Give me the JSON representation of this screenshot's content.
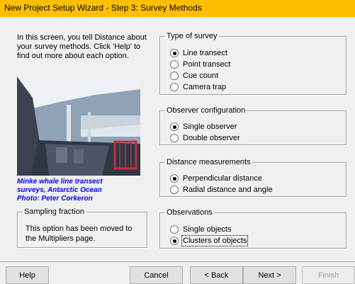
{
  "window": {
    "title": "New Project Setup Wizard - Step 3: Survey Methods"
  },
  "intro": {
    "text": "In this screen, you tell Distance about your survey methods.  Click 'Help' to find out more about each option."
  },
  "photo": {
    "caption_line1": "Minke whale line transect",
    "caption_line2": "surveys, Antarctic Ocean",
    "caption_line3": "Photo: Peter Corkeron"
  },
  "sampling": {
    "legend": "Sampling fraction",
    "text": "This option has been moved to the Multipliers page."
  },
  "type_of_survey": {
    "legend": "Type of survey",
    "options": [
      "Line transect",
      "Point transect",
      "Cue count",
      "Camera trap"
    ],
    "selected": "Line transect"
  },
  "observer_configuration": {
    "legend": "Observer configuration",
    "options": [
      "Single observer",
      "Double observer"
    ],
    "selected": "Single observer"
  },
  "distance_measurements": {
    "legend": "Distance measurements",
    "options": [
      "Perpendicular distance",
      "Radial distance and angle"
    ],
    "selected": "Perpendicular distance"
  },
  "observations": {
    "legend": "Observations",
    "options": [
      "Single objects",
      "Clusters of objects"
    ],
    "selected": "Clusters of objects"
  },
  "buttons": {
    "help": "Help",
    "cancel": "Cancel",
    "back": "< Back",
    "next": "Next >",
    "finish": "Finish"
  },
  "colors": {
    "titlebar": "#ffbf00",
    "caption": "#0000ff",
    "background": "#f0f0f0"
  }
}
